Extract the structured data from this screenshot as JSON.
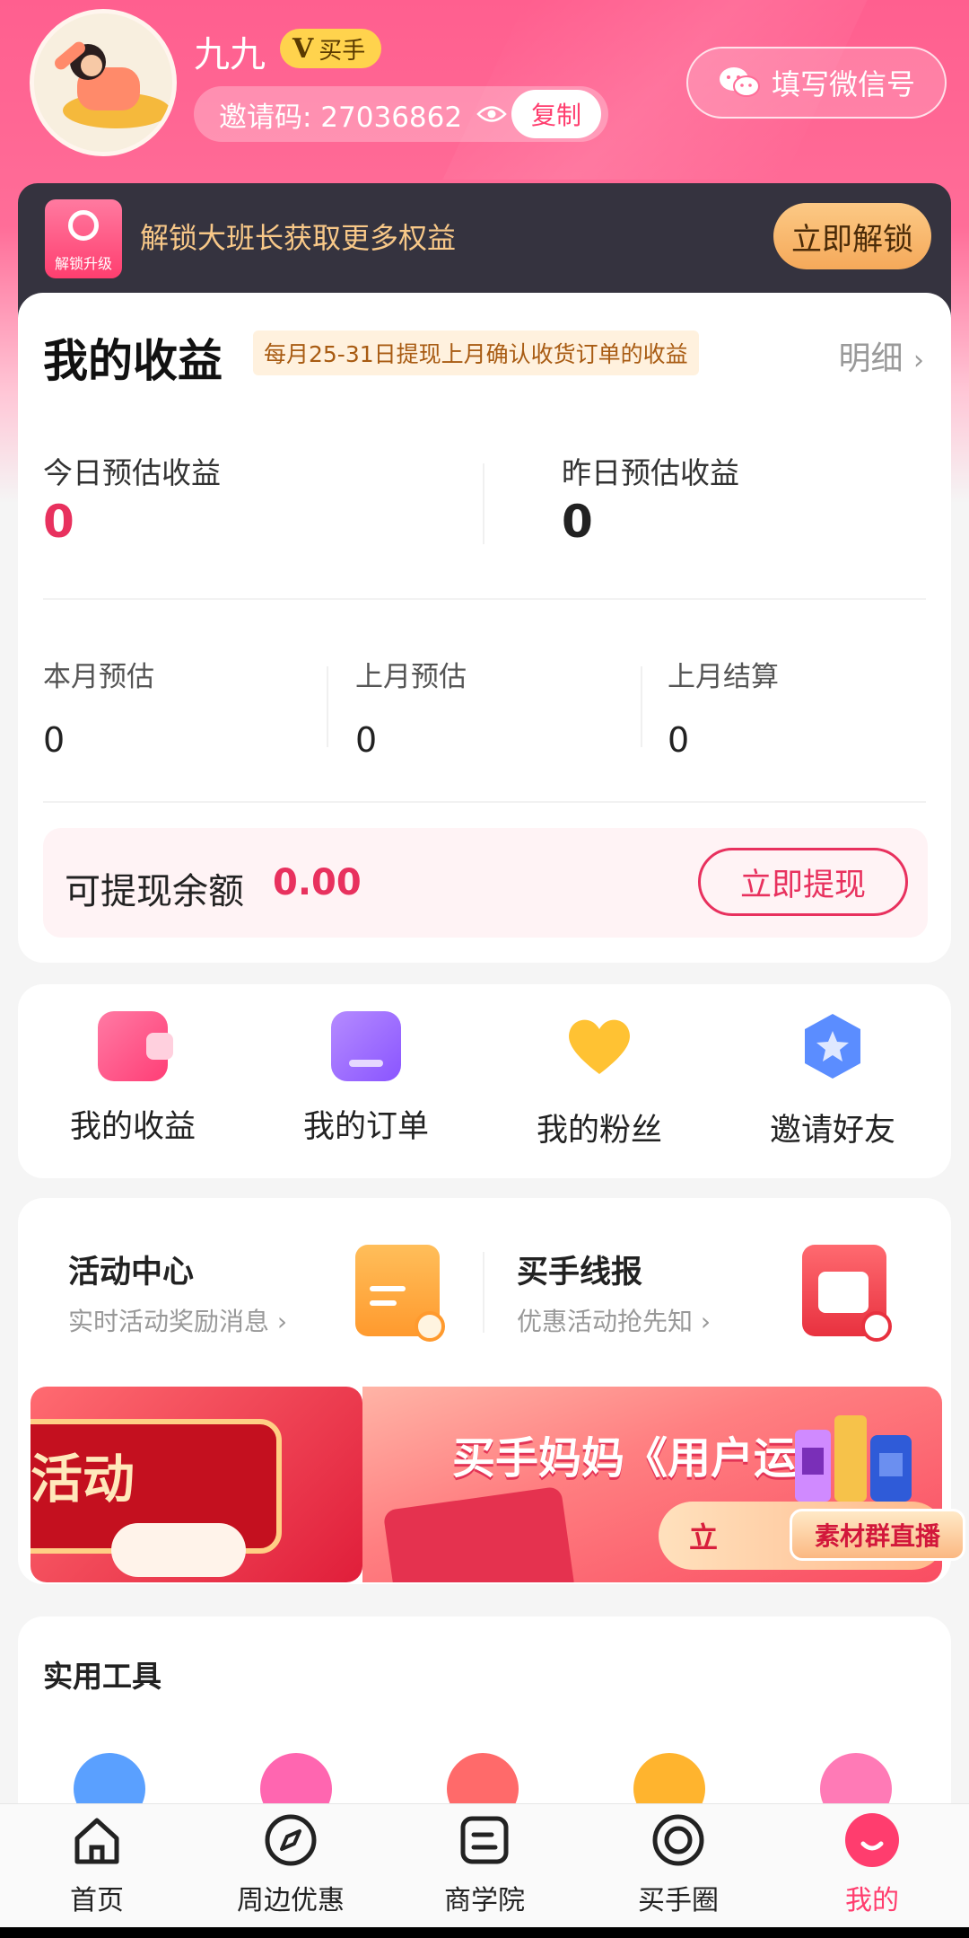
{
  "profile": {
    "name": "九九",
    "badge": "买手",
    "invite_label": "邀请码: 27036862",
    "copy_label": "复制",
    "wechat_label": "填写微信号"
  },
  "unlock": {
    "icon_label": "解锁升级",
    "text": "解锁大班长获取更多权益",
    "button": "立即解锁"
  },
  "earnings": {
    "title": "我的收益",
    "note": "每月25-31日提现上月确认收货订单的收益",
    "detail": "明细",
    "today_label": "今日预估收益",
    "today_value": "0",
    "yesterday_label": "昨日预估收益",
    "yesterday_value": "0",
    "month_label": "本月预估",
    "month_value": "0",
    "last_month_label": "上月预估",
    "last_month_value": "0",
    "last_settle_label": "上月结算",
    "last_settle_value": "0",
    "balance_label": "可提现余额",
    "balance_value": "0.00",
    "withdraw_button": "立即提现"
  },
  "quick": [
    {
      "label": "我的收益",
      "icon": "wallet-icon",
      "color": "#ff5a8a"
    },
    {
      "label": "我的订单",
      "icon": "store-icon",
      "color": "#9b6bff"
    },
    {
      "label": "我的粉丝",
      "icon": "heart-icon",
      "color": "#ffc233"
    },
    {
      "label": "邀请好友",
      "icon": "star-badge-icon",
      "color": "#5b8dff"
    }
  ],
  "activity": {
    "left_title": "活动中心",
    "left_sub": "实时活动奖励消息",
    "right_title": "买手线报",
    "right_sub": "优惠活动抢先知",
    "banner_left_text": "活动",
    "banner_right_text": "买手妈妈《用户运",
    "banner_right_btn": "立",
    "live_tag": "素材群直播"
  },
  "tools": {
    "title": "实用工具"
  },
  "nav": [
    {
      "label": "首页",
      "icon": "home-icon"
    },
    {
      "label": "周边优惠",
      "icon": "compass-icon"
    },
    {
      "label": "商学院",
      "icon": "book-icon"
    },
    {
      "label": "买手圈",
      "icon": "circle-gear-icon"
    },
    {
      "label": "我的",
      "icon": "profile-icon"
    }
  ],
  "colors": {
    "brand_pink": "#ff3d6e",
    "accent_gold": "#ffd34d",
    "dark_bar": "#35333f"
  }
}
